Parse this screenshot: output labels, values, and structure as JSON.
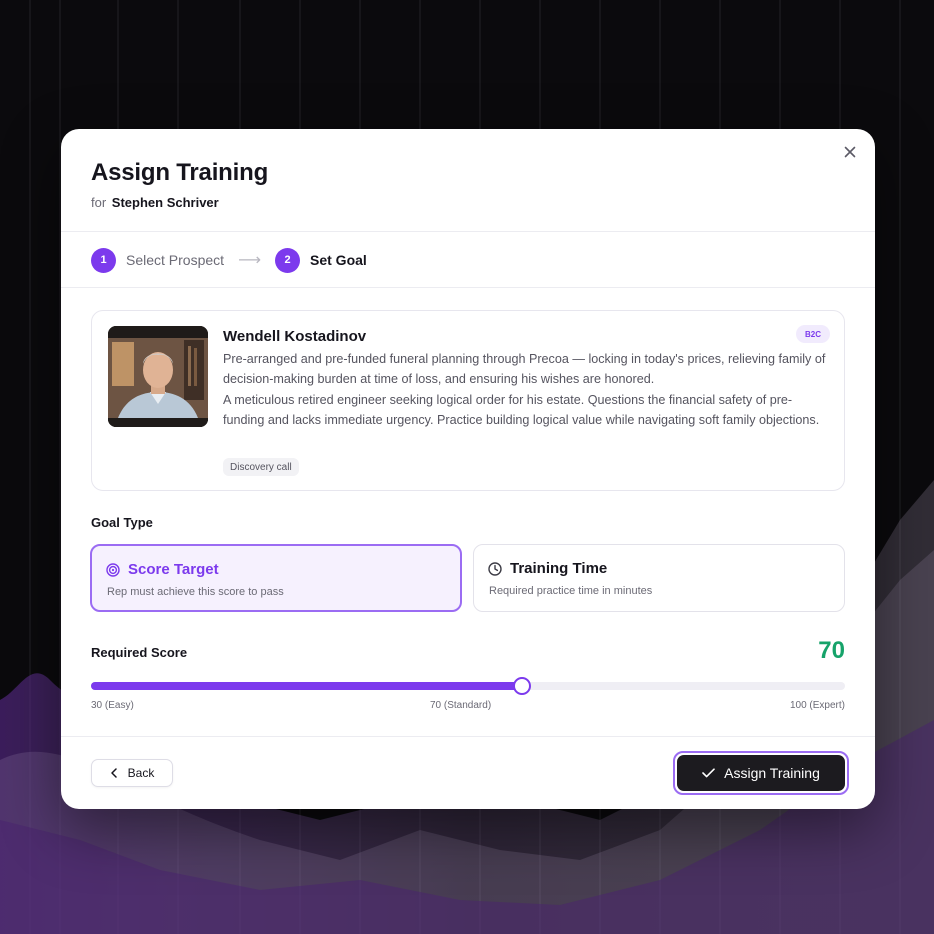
{
  "modal": {
    "title": "Assign Training",
    "subtitle_prefix": "for",
    "subtitle_name": "Stephen Schriver",
    "close_icon": "close-icon"
  },
  "steps": [
    {
      "number": "1",
      "label": "Select Prospect",
      "state": "inactive"
    },
    {
      "number": "2",
      "label": "Set Goal",
      "state": "active"
    }
  ],
  "prospect": {
    "name": "Wendell Kostadinov",
    "badge": "B2C",
    "description_1": "Pre-arranged and pre-funded funeral planning through Precoa — locking in today's prices, relieving family of decision-making burden at time of loss, and ensuring his wishes are honored.",
    "description_2": "A meticulous retired engineer seeking logical order for his estate. Questions the financial safety of pre-funding and lacks immediate urgency. Practice building logical value while navigating soft family objections.",
    "call_type": "Discovery call"
  },
  "goal_type": {
    "label": "Goal Type",
    "options": [
      {
        "title": "Score Target",
        "description": "Rep must achieve this score to pass",
        "icon": "target-icon",
        "selected": true
      },
      {
        "title": "Training Time",
        "description": "Required practice time in minutes",
        "icon": "clock-icon",
        "selected": false
      }
    ]
  },
  "required_score": {
    "label": "Required Score",
    "value": "70",
    "min": 30,
    "max": 100,
    "current": 70,
    "tick_min": "30 (Easy)",
    "tick_mid": "70 (Standard)",
    "tick_max": "100 (Expert)"
  },
  "footer": {
    "back_label": "Back",
    "assign_label": "Assign Training"
  },
  "colors": {
    "accent": "#7c3aed",
    "score": "#16a36a",
    "primary_button": "#1c1b1f"
  }
}
